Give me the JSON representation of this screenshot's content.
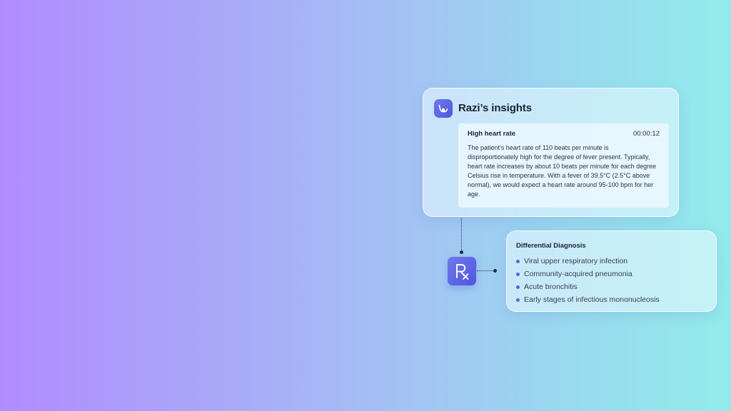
{
  "insights": {
    "title": "Razi’s insights",
    "logo_icon": "razi-logo-icon",
    "note": {
      "heading": "High heart rate",
      "timestamp": "00:00:12",
      "body": "The patient's heart rate of 110 beats per minute is disproportionately high for the degree of fever present. Typically, heart rate increases by about 10 beats per minute for each degree Celsius rise in temperature. With a fever of 39.5°C (2.5°C above normal), we would expect a heart rate around 95-100 bpm for her age."
    }
  },
  "rx_badge": {
    "icon": "prescription-rx-icon"
  },
  "diagnosis": {
    "title": "Differential Diagnosis",
    "items": [
      "Viral upper respiratory infection",
      "Community-acquired pneumonia",
      "Acute bronchitis",
      "Early stages of infectious mononucleosis"
    ]
  },
  "colors": {
    "accent": "#5a63e0",
    "gradient_start": "#b18cff",
    "gradient_end": "#92ebeb"
  }
}
